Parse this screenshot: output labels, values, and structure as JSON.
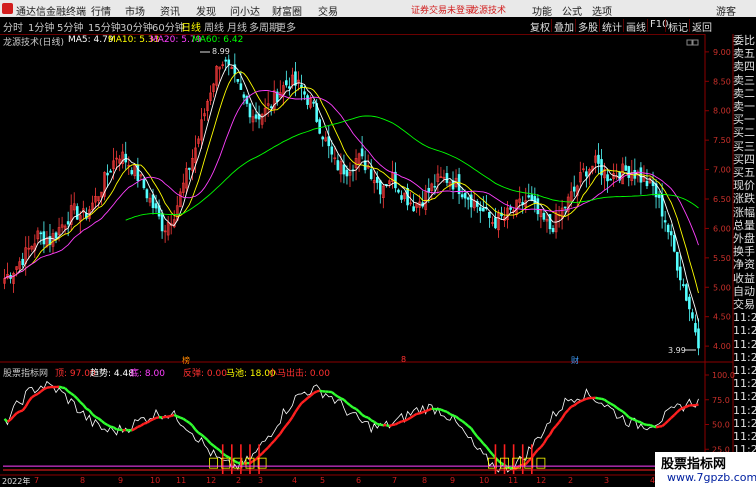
{
  "menubar": {
    "app_title": "通达信金融终端",
    "items": [
      "行情",
      "市场",
      "资讯",
      "发现",
      "问小达",
      "财富圈",
      "交易"
    ],
    "warning": "证券交易未登录",
    "brand": "龙源技术",
    "right_items": [
      "功能",
      "公式",
      "选项",
      "游客"
    ]
  },
  "toolbar": {
    "periods": [
      "分时",
      "1分钟",
      "5分钟",
      "15分钟",
      "30分钟",
      "60分钟",
      "日线",
      "周线",
      "月线",
      "多周期",
      "更多"
    ],
    "active_period": "日线",
    "right_buttons": [
      "复权",
      "叠加",
      "多股",
      "统计",
      "画线",
      "F10",
      "标记",
      "返回"
    ]
  },
  "main_indicator": {
    "name": "龙源技术(日线)",
    "ma5": "MA5: 4.79",
    "ma10": "MA10: 5.33",
    "ma20": "MA20: 5.79",
    "ma60": "MA60: 6.42",
    "high_label": "8.99",
    "low_label": "3.99",
    "yaxis_ticks": [
      "9.00",
      "8.50",
      "8.00",
      "7.50",
      "7.00",
      "6.50",
      "6.00",
      "5.50",
      "5.00",
      "4.50",
      "4.00"
    ]
  },
  "events": [
    {
      "label": "榜",
      "color": "#ff8800"
    },
    {
      "label": "8",
      "color": "#ff3030"
    },
    {
      "label": "财",
      "color": "#40a0ff"
    }
  ],
  "sub_indicator": {
    "name": "股票指标网",
    "fields": [
      {
        "label": "顶: 97.00",
        "color": "#ff3030"
      },
      {
        "label": "趋势: 4.48",
        "color": "#ffffff"
      },
      {
        "label": "底: 8.00",
        "color": "#ff40ff"
      },
      {
        "label": "反弹: 0.00",
        "color": "#ff3030"
      },
      {
        "label": "马池: 18.00",
        "color": "#ffff00"
      },
      {
        "label": "小马出击: 0.00",
        "color": "#ff3030"
      }
    ],
    "yaxis_ticks": [
      "100.0",
      "75.0",
      "50.0",
      "25.0",
      "0.0"
    ]
  },
  "xaxis": {
    "year_label": "2022年",
    "months": [
      "7",
      "8",
      "9",
      "10",
      "11",
      "12",
      "2",
      "3",
      "4",
      "5",
      "6",
      "7",
      "8",
      "9",
      "10",
      "11",
      "12",
      "2",
      "3",
      "4"
    ]
  },
  "side_panel": {
    "labels": [
      "委比",
      "卖五",
      "卖四",
      "卖三",
      "卖二",
      "卖一",
      "买一",
      "买二",
      "买三",
      "买四",
      "买五",
      "现价",
      "涨跌",
      "涨幅",
      "总量",
      "外盘",
      "换手",
      "净资",
      "收益",
      "自动",
      "交易",
      "11:27",
      "11:27",
      "11:28",
      "11:28",
      "11:28",
      "11:28",
      "11:28",
      "11:28",
      "11:28",
      "11:28",
      "11:28",
      "11:28",
      "11:28"
    ]
  },
  "chart_data": {
    "type": "candlestick",
    "series": [
      {
        "name": "MA5",
        "color": "#ffffff"
      },
      {
        "name": "MA10",
        "color": "#ffff00"
      },
      {
        "name": "MA20",
        "color": "#ff40ff"
      },
      {
        "name": "MA60",
        "color": "#00ff00"
      }
    ],
    "ylim": [
      3.9,
      9.1
    ],
    "close_profile": [
      5.15,
      5.35,
      5.6,
      5.9,
      5.8,
      6.05,
      6.3,
      6.2,
      6.5,
      6.9,
      7.3,
      7.1,
      6.8,
      6.4,
      6.0,
      6.3,
      6.9,
      7.5,
      8.3,
      8.9,
      8.6,
      8.2,
      7.9,
      8.0,
      8.3,
      8.5,
      8.4,
      8.1,
      7.6,
      7.1,
      7.0,
      7.2,
      7.05,
      6.7,
      6.9,
      6.6,
      6.4,
      6.55,
      6.8,
      6.85,
      6.7,
      6.5,
      6.3,
      6.1,
      6.2,
      6.35,
      6.5,
      6.2,
      6.0,
      6.3,
      6.6,
      7.0,
      7.1,
      6.9,
      6.95,
      7.0,
      6.85,
      6.7,
      6.2,
      5.5,
      4.8,
      4.1
    ],
    "sub_ylim": [
      0,
      100
    ]
  },
  "watermark": {
    "title": "股票指标网",
    "url": "www.7gpzb.com"
  }
}
